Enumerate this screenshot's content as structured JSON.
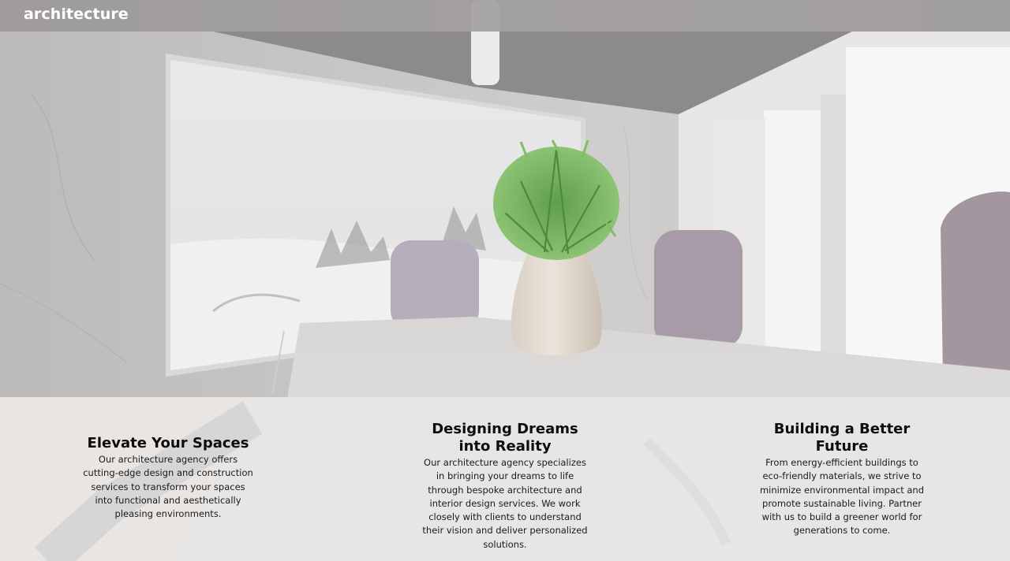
{
  "header": {
    "logo_text": "architecture"
  },
  "hero": {
    "scene": "meeting-room-render",
    "colors": {
      "ceiling": "#8d8b89",
      "wall": "#cfcdcb",
      "window": "#f3f3f3",
      "chair": "#a79aa7",
      "table": "#dcdad8",
      "plant": "#6fae5a",
      "vase": "#e3dad0"
    }
  },
  "features": [
    {
      "title": "Elevate Your Spaces",
      "body": "Our architecture agency offers cutting-edge design and construction services to transform your spaces into functional and aesthetically pleasing environments."
    },
    {
      "title": "Designing Dreams into Reality",
      "body": "Our architecture agency specializes in bringing your dreams to life through bespoke architecture and interior design services. We work closely with clients to understand their vision and deliver personalized solutions."
    },
    {
      "title": "Building a Better Future",
      "body": "From energy-efficient buildings to eco-friendly materials, we strive to minimize environmental impact and promote sustainable living. Partner with us to build a greener world for generations to come."
    }
  ]
}
